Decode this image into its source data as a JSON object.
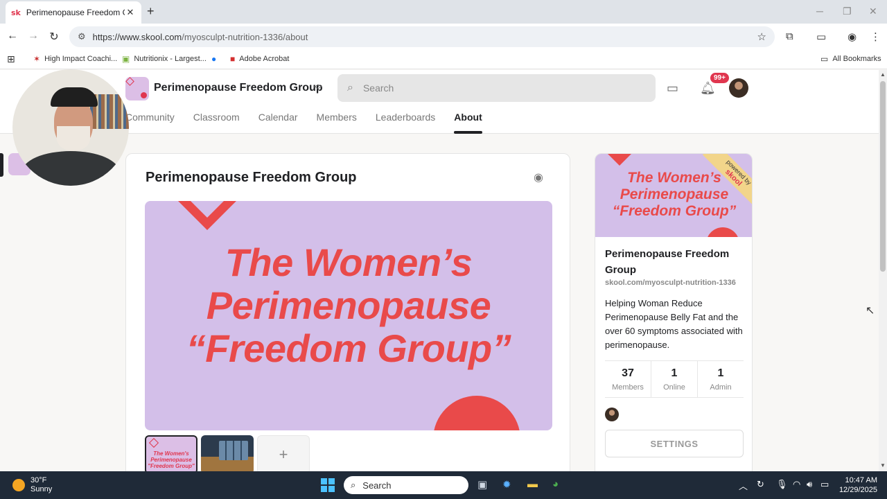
{
  "browser": {
    "tab_favicon": "sk",
    "tab_title": "Perimenopause Freedom Group",
    "url_host": "https://www.skool.com",
    "url_path": "/myosculpt-nutrition-1336/about",
    "bookmarks": [
      {
        "label": "High Impact Coachi...",
        "icon": "star-burst-icon"
      },
      {
        "label": "Nutritionix - Largest...",
        "icon": "android-icon"
      },
      {
        "label": "",
        "icon": "facebook-icon"
      },
      {
        "label": "Adobe Acrobat",
        "icon": "acrobat-icon"
      }
    ],
    "all_bookmarks": "All Bookmarks"
  },
  "header": {
    "group_name": "Perimenopause Freedom Group",
    "search_placeholder": "Search",
    "notification_badge": "99+"
  },
  "nav": {
    "tabs": [
      {
        "label": "Community",
        "active": false
      },
      {
        "label": "Classroom",
        "active": false
      },
      {
        "label": "Calendar",
        "active": false
      },
      {
        "label": "Members",
        "active": false
      },
      {
        "label": "Leaderboards",
        "active": false
      },
      {
        "label": "About",
        "active": true
      }
    ]
  },
  "main": {
    "title": "Perimenopause Freedom Group",
    "hero_line1": "The Women’s",
    "hero_line2": "Perimenopause",
    "hero_line3": "“Freedom Group”",
    "thumb_line1": "The Women's",
    "thumb_line2": "Perimenopause",
    "thumb_line3": "\"Freedom Group\"",
    "add_thumb": "+"
  },
  "side": {
    "hero_line1": "The Women’s",
    "hero_line2": "Perimenopause",
    "hero_line3": "“Freedom Group”",
    "ribbon_top": "powered by",
    "ribbon_brand": "skool",
    "name": "Perimenopause Freedom Group",
    "url": "skool.com/myosculpt-nutrition-1336",
    "description": "Helping Woman Reduce Perimenopause Belly Fat and the over 60 symptoms associated with perimenopause.",
    "stats": [
      {
        "value": "37",
        "label": "Members"
      },
      {
        "value": "1",
        "label": "Online"
      },
      {
        "value": "1",
        "label": "Admin"
      }
    ],
    "settings_label": "SETTINGS"
  },
  "taskbar": {
    "temperature": "30°F",
    "condition": "Sunny",
    "search_label": "Search",
    "time": "10:47 AM",
    "date": "12/29/2025"
  },
  "colors": {
    "accent_red": "#e94a4a",
    "hero_purple": "#d3bfe9",
    "badge_red": "#e0364f",
    "taskbar": "#1f2a38"
  }
}
